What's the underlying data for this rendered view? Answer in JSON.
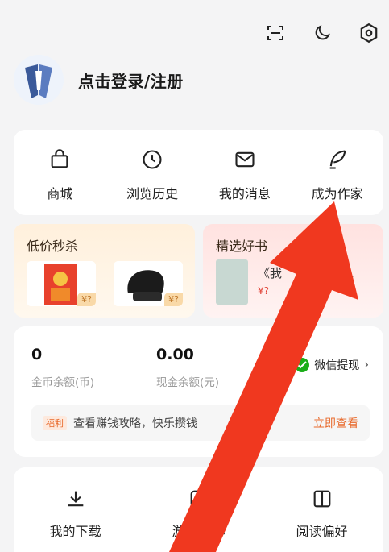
{
  "header": {
    "icons": [
      "scan-icon",
      "moon-icon",
      "settings-icon"
    ],
    "login_label": "点击登录/注册"
  },
  "quick_menu": [
    {
      "label": "商城",
      "icon": "shopping-bag-icon"
    },
    {
      "label": "浏览历史",
      "icon": "clock-icon"
    },
    {
      "label": "我的消息",
      "icon": "mail-icon"
    },
    {
      "label": "成为作家",
      "icon": "quill-icon"
    }
  ],
  "promo_left": {
    "title": "低价秒杀",
    "items": [
      {
        "price": "¥?"
      },
      {
        "price": "¥?"
      }
    ]
  },
  "promo_right": {
    "title": "精选好书",
    "book_title": "《我",
    "book_price": "¥?",
    "ellipsis": "》…"
  },
  "balance": {
    "coins_value": "0",
    "coins_label": "金币余额(币)",
    "cash_value": "0.00",
    "cash_label": "现金余额(元)",
    "withdraw_label": "微信提现",
    "tip_tag": "福利",
    "tip_text": "查看赚钱攻略，快乐攒钱",
    "tip_link": "立即查看"
  },
  "bottom_menu": [
    {
      "label": "我的下载",
      "icon": "download-icon"
    },
    {
      "label": "游",
      "label2": "中心",
      "icon": "game-icon"
    },
    {
      "label": "阅读偏好",
      "icon": "book-icon"
    }
  ],
  "colors": {
    "accent": "#e86a2c",
    "arrow": "#f0381f",
    "wechat": "#1aad19"
  }
}
